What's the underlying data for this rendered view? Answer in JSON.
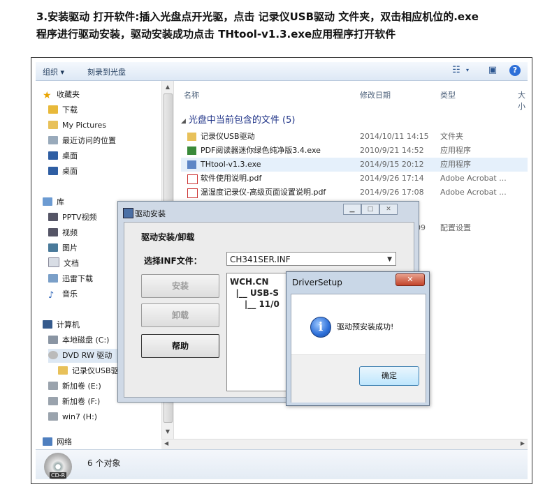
{
  "instruction": {
    "line1": "3.安装驱动 打开软件:插入光盘点开光驱，点击 记录仪USB驱动 文件夹，双击相应机位的.exe",
    "line2": "程序进行驱动安装，驱动安装成功点击 THtool-v1.3.exe应用程序打开软件"
  },
  "explorer": {
    "toolbar": {
      "organize": "组织 ▾",
      "burn": "刻录到光盘"
    },
    "nav": [
      {
        "label": "收藏夹",
        "icon": "star-icon"
      },
      {
        "label": "下载",
        "icon": "download-folder-icon"
      },
      {
        "label": "My Pictures",
        "icon": "folder-icon"
      },
      {
        "label": "最近访问的位置",
        "icon": "recent-places-icon"
      },
      {
        "label": "桌面",
        "icon": "desktop-icon"
      },
      {
        "label": "桌面",
        "icon": "desktop-icon"
      },
      {
        "label": "库",
        "icon": "library-icon"
      },
      {
        "label": "PPTV视频",
        "icon": "video-library-icon"
      },
      {
        "label": "视频",
        "icon": "video-library-icon"
      },
      {
        "label": "图片",
        "icon": "picture-library-icon"
      },
      {
        "label": "文档",
        "icon": "document-library-icon"
      },
      {
        "label": "迅雷下载",
        "icon": "download-library-icon"
      },
      {
        "label": "音乐",
        "icon": "music-library-icon"
      },
      {
        "label": "计算机",
        "icon": "computer-icon"
      },
      {
        "label": "本地磁盘 (C:)",
        "icon": "drive-icon"
      },
      {
        "label": "DVD RW 驱动",
        "icon": "dvd-drive-icon"
      },
      {
        "label": "记录仪USB驱",
        "icon": "folder-icon"
      },
      {
        "label": "新加卷 (E:)",
        "icon": "drive-icon"
      },
      {
        "label": "新加卷 (F:)",
        "icon": "drive-icon"
      },
      {
        "label": "win7 (H:)",
        "icon": "drive-icon"
      },
      {
        "label": "网络",
        "icon": "network-icon"
      }
    ],
    "columns": {
      "name": "名称",
      "date": "修改日期",
      "type": "类型",
      "size": "大小"
    },
    "group_header": "光盘中当前包含的文件 (5)",
    "files": [
      {
        "name": "记录仪USB驱动",
        "date": "2014/10/11 14:15",
        "type": "文件夹",
        "icon": "folder-icon"
      },
      {
        "name": "PDF阅读器迷你绿色纯净版3.4.exe",
        "date": "2010/9/21 14:52",
        "type": "应用程序",
        "icon": "pdf-exe-icon"
      },
      {
        "name": "THtool-v1.3.exe",
        "date": "2014/9/15 20:12",
        "type": "应用程序",
        "icon": "app-exe-icon"
      },
      {
        "name": "软件使用说明.pdf",
        "date": "2014/9/26 17:14",
        "type": "Adobe Acrobat ...",
        "icon": "pdf-icon"
      },
      {
        "name": "温湿度记录仪-高级页面设置说明.pdf",
        "date": "2014/9/26 17:08",
        "type": "Adobe Acrobat ...",
        "icon": "pdf-icon"
      }
    ],
    "partial_row": {
      "date": "09",
      "type": "配置设置"
    },
    "status": {
      "count": "6 个对象",
      "disc_label": "CD-R"
    }
  },
  "driver_window": {
    "title": "驱动安装",
    "subtitle": "驱动安装/卸载",
    "inf_label": "选择INF文件：",
    "inf_value": "CH341SER.INF",
    "install": "安装",
    "uninstall": "卸载",
    "help": "帮助",
    "info_text": "WCH.CN\n  |__ USB-S\n     |__ 11/0"
  },
  "setup_dialog": {
    "title": "DriverSetup",
    "message": "驱动预安装成功!",
    "ok": "确定"
  },
  "colors": {
    "accent": "#1e3287",
    "selection": "#e5f0fb"
  }
}
